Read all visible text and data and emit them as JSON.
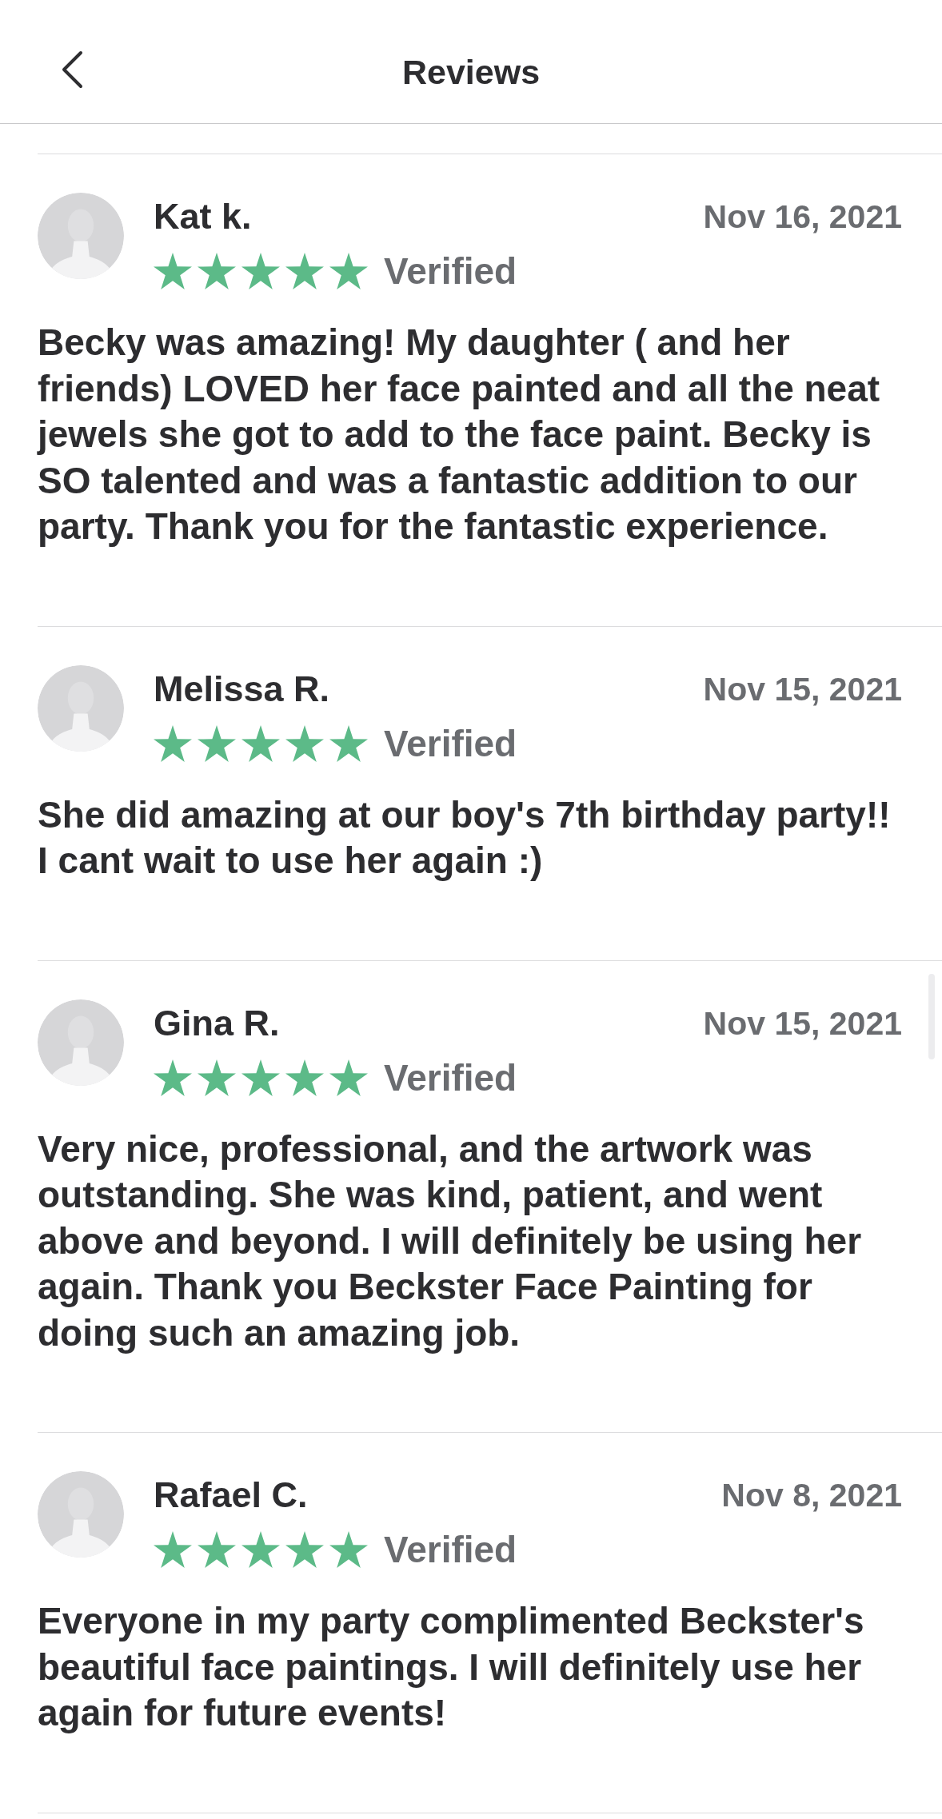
{
  "header": {
    "title": "Reviews"
  },
  "reviews": [
    {
      "name": "Kat k.",
      "date": "Nov 16, 2021",
      "stars": 5,
      "verified_label": "Verified",
      "text": "Becky was amazing! My daughter ( and her friends) LOVED her face painted and all the neat jewels she got to add to the face paint. Becky is SO talented and was a fantastic addition to our party. Thank you for the fantastic experience."
    },
    {
      "name": "Melissa R.",
      "date": "Nov 15, 2021",
      "stars": 5,
      "verified_label": "Verified",
      "text": "She did amazing at our boy's 7th birthday party!! I cant wait to use her again :)"
    },
    {
      "name": "Gina R.",
      "date": "Nov 15, 2021",
      "stars": 5,
      "verified_label": "Verified",
      "text": "Very nice, professional, and the artwork was outstanding. She was kind, patient, and went above and beyond. I will definitely be using her again. Thank you Beckster Face Painting for doing such an amazing job."
    },
    {
      "name": "Rafael C.",
      "date": "Nov 8, 2021",
      "stars": 5,
      "verified_label": "Verified",
      "text": "Everyone in my party complimented Beckster's beautiful face paintings. I will definitely use her again for future events!"
    }
  ]
}
